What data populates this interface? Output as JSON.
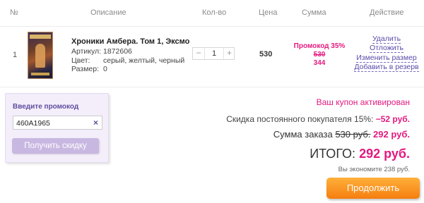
{
  "table": {
    "headers": [
      "№",
      "Описание",
      "Кол-во",
      "Цена",
      "Сумма",
      "Действие"
    ]
  },
  "item": {
    "number": "1",
    "cover_icon": "book-cover-image",
    "title": "Хроники Амбера. Том 1, Эксмо",
    "attributes": [
      {
        "label": "Артикул:",
        "value": "1872606"
      },
      {
        "label": "Цвет:",
        "value": "серый, желтый, черный"
      },
      {
        "label": "Размер:",
        "value": "0"
      }
    ],
    "quantity": {
      "minus": "−",
      "value": "1",
      "plus": "+"
    },
    "price": "530",
    "sum": {
      "promo_label": "Промокод 35%",
      "old_price": "530",
      "new_price": "344"
    },
    "actions": [
      "Удалить",
      "Отложить",
      "Изменить размер",
      "Добавить в резерв"
    ]
  },
  "promo": {
    "label": "Введите промокод",
    "input_value": "460A1965",
    "clear_icon": "×",
    "button_label": "Получить скидку"
  },
  "summary": {
    "coupon_message": "Ваш купон активирован",
    "loyalty_label": "Скидка постоянного покупателя 15%:",
    "loyalty_value": "−52 руб.",
    "order_label": "Сумма заказа",
    "order_old": "530 руб.",
    "order_new": "292 руб.",
    "total_label": "ИТОГО:",
    "total_value": "292 руб.",
    "savings": "Вы экономите 238 руб."
  },
  "continue_button": "Продолжить",
  "colors": {
    "accent_pink": "#e3197f",
    "link_purple": "#5b4aa8",
    "orange_button": "#f57e10"
  }
}
